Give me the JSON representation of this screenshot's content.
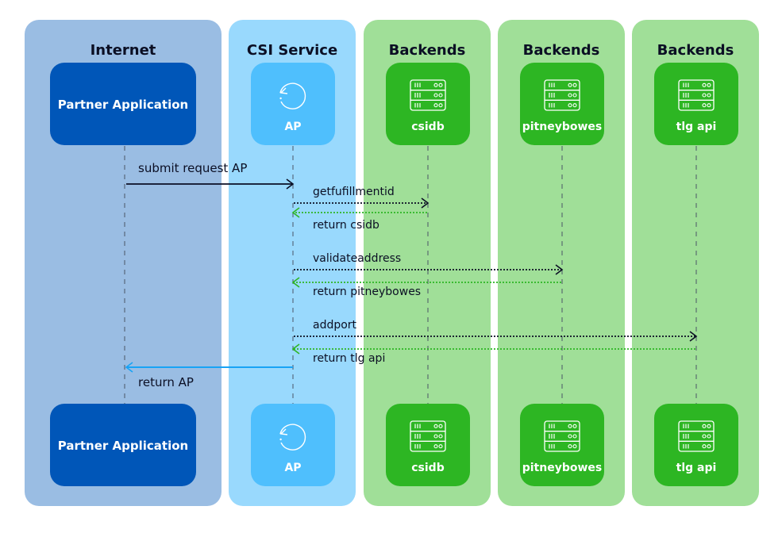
{
  "colors": {
    "internet_lane": "#9abde3",
    "service_lane": "#99d9fd",
    "backend_lane": "#a0df98",
    "partner_node": "#0056b8",
    "ap_node": "#4fbffd",
    "backend_node": "#2db623",
    "request_line": "#0b0f24",
    "return_backend_line": "#2db623",
    "return_ap_line": "#18a3f5"
  },
  "lanes": [
    {
      "id": "internet",
      "title": "Internet"
    },
    {
      "id": "csi-service",
      "title": "CSI Service"
    },
    {
      "id": "backends-1",
      "title": "Backends"
    },
    {
      "id": "backends-2",
      "title": "Backends"
    },
    {
      "id": "backends-3",
      "title": "Backends"
    }
  ],
  "participants": [
    {
      "id": "partner",
      "label": "Partner Application",
      "icon": "none"
    },
    {
      "id": "ap",
      "label": "AP",
      "icon": "refresh-icon"
    },
    {
      "id": "csidb",
      "label": "csidb",
      "icon": "server-icon"
    },
    {
      "id": "pitneybowes",
      "label": "pitneybowes",
      "icon": "server-icon"
    },
    {
      "id": "tlgapi",
      "label": "tlg api",
      "icon": "server-icon"
    }
  ],
  "messages": [
    {
      "from": "partner",
      "to": "ap",
      "label": "submit request AP",
      "style": "solid",
      "kind": "request"
    },
    {
      "from": "ap",
      "to": "csidb",
      "label": "getfufillmentid",
      "style": "dotted",
      "kind": "request"
    },
    {
      "from": "csidb",
      "to": "ap",
      "label": "return csidb",
      "style": "dotted",
      "kind": "return"
    },
    {
      "from": "ap",
      "to": "pitneybowes",
      "label": "validateaddress",
      "style": "dotted",
      "kind": "request"
    },
    {
      "from": "pitneybowes",
      "to": "ap",
      "label": "return pitneybowes",
      "style": "dotted",
      "kind": "return"
    },
    {
      "from": "ap",
      "to": "tlgapi",
      "label": "addport",
      "style": "dotted",
      "kind": "request"
    },
    {
      "from": "tlgapi",
      "to": "ap",
      "label": "return tlg api",
      "style": "dotted",
      "kind": "return"
    },
    {
      "from": "ap",
      "to": "partner",
      "label": "return AP",
      "style": "solid",
      "kind": "final-return"
    }
  ]
}
